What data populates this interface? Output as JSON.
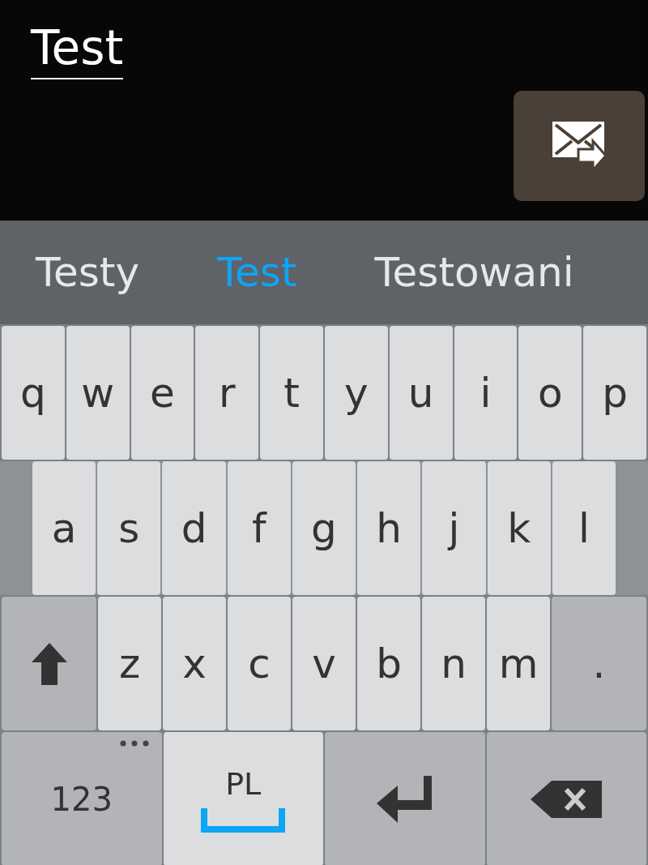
{
  "message": {
    "value": "Test"
  },
  "send_button": {
    "kind": "send"
  },
  "suggestions": [
    {
      "text": "Testy",
      "selected": false
    },
    {
      "text": "Test",
      "selected": true
    },
    {
      "text": "Testowani",
      "selected": false
    }
  ],
  "keyboard": {
    "rows": [
      {
        "inset": false,
        "keys": [
          {
            "kind": "letter",
            "label": "q"
          },
          {
            "kind": "letter",
            "label": "w"
          },
          {
            "kind": "letter",
            "label": "e"
          },
          {
            "kind": "letter",
            "label": "r"
          },
          {
            "kind": "letter",
            "label": "t"
          },
          {
            "kind": "letter",
            "label": "y"
          },
          {
            "kind": "letter",
            "label": "u"
          },
          {
            "kind": "letter",
            "label": "i"
          },
          {
            "kind": "letter",
            "label": "o"
          },
          {
            "kind": "letter",
            "label": "p"
          }
        ]
      },
      {
        "inset": true,
        "keys": [
          {
            "kind": "letter",
            "label": "a"
          },
          {
            "kind": "letter",
            "label": "s"
          },
          {
            "kind": "letter",
            "label": "d"
          },
          {
            "kind": "letter",
            "label": "f"
          },
          {
            "kind": "letter",
            "label": "g"
          },
          {
            "kind": "letter",
            "label": "h"
          },
          {
            "kind": "letter",
            "label": "j"
          },
          {
            "kind": "letter",
            "label": "k"
          },
          {
            "kind": "letter",
            "label": "l"
          }
        ]
      },
      {
        "inset": false,
        "keys": [
          {
            "kind": "shift"
          },
          {
            "kind": "letter",
            "label": "z"
          },
          {
            "kind": "letter",
            "label": "x"
          },
          {
            "kind": "letter",
            "label": "c"
          },
          {
            "kind": "letter",
            "label": "v"
          },
          {
            "kind": "letter",
            "label": "b"
          },
          {
            "kind": "letter",
            "label": "n"
          },
          {
            "kind": "letter",
            "label": "m"
          },
          {
            "kind": "symbol",
            "label": "."
          }
        ]
      },
      {
        "inset": false,
        "keys": [
          {
            "kind": "mode",
            "label": "123"
          },
          {
            "kind": "space",
            "label": "PL"
          },
          {
            "kind": "enter"
          },
          {
            "kind": "backspace"
          }
        ]
      }
    ]
  }
}
